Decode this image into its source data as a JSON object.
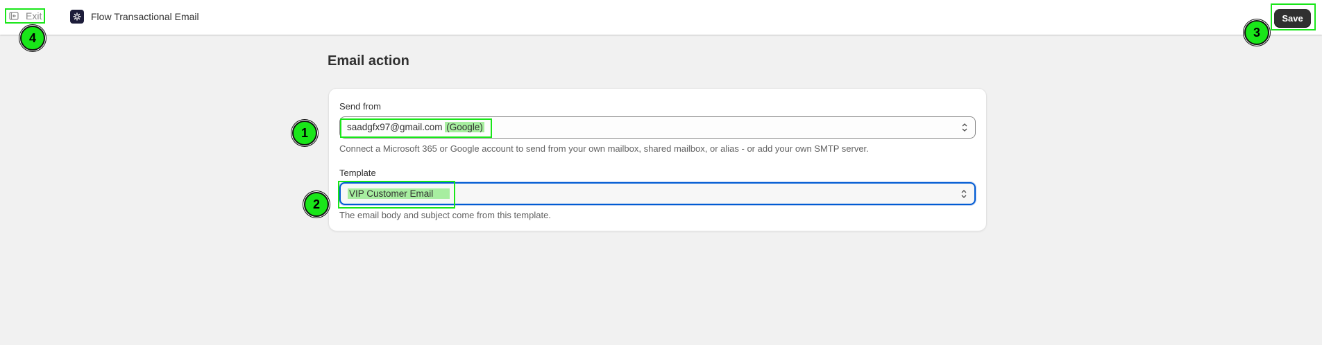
{
  "topbar": {
    "exit_label": "Exit",
    "app_title": "Flow Transactional Email",
    "save_label": "Save"
  },
  "page": {
    "heading": "Email action"
  },
  "send_from": {
    "label": "Send from",
    "value": "saadgfx97@gmail.com",
    "provider": "(Google)",
    "help": "Connect a Microsoft 365 or Google account to send from your own mailbox, shared mailbox, or alias - or add your own SMTP server."
  },
  "template": {
    "label": "Template",
    "value": "VIP Customer Email",
    "help": "The email body and subject come from this template."
  },
  "markers": {
    "m1": "1",
    "m2": "2",
    "m3": "3",
    "m4": "4"
  },
  "colors": {
    "annotation_green": "#19e619",
    "focus_blue": "#005bd3",
    "primary_button": "#303030"
  }
}
